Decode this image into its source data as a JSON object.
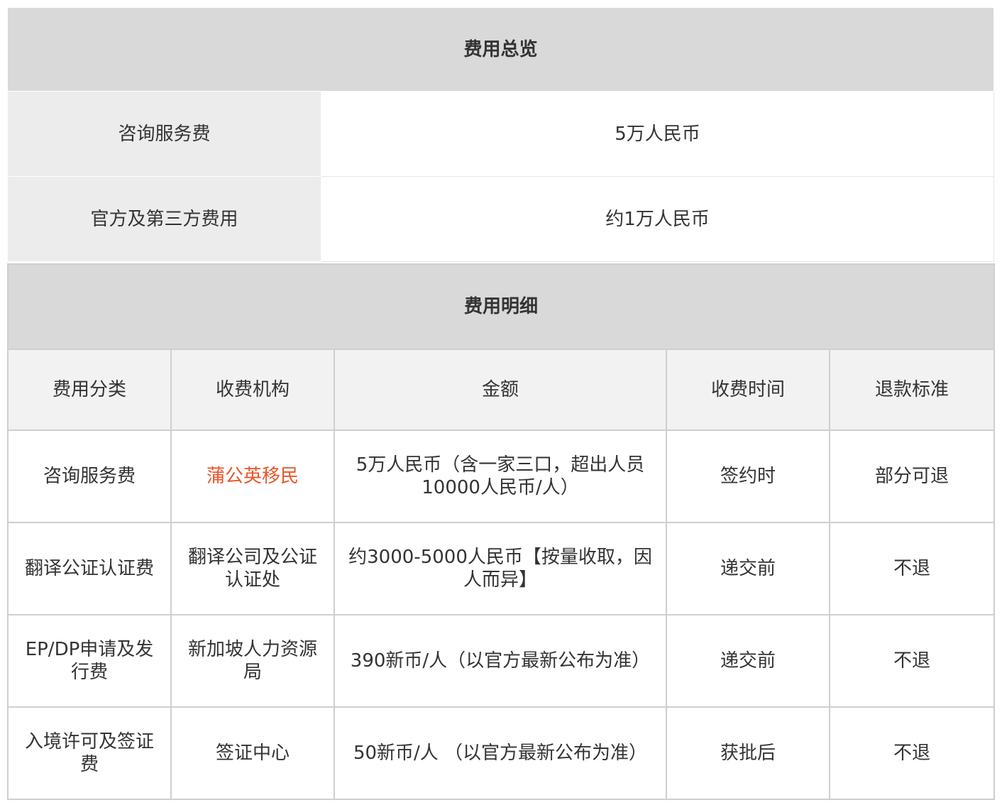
{
  "overview": {
    "title": "费用总览",
    "rows": [
      {
        "label": "咨询服务费",
        "value": "5万人民币"
      },
      {
        "label": "官方及第三方费用",
        "value": "约1万人民币"
      }
    ]
  },
  "detail": {
    "title": "费用明细",
    "headers": [
      "费用分类",
      "收费机构",
      "金额",
      "收费时间",
      "退款标准"
    ],
    "rows": [
      {
        "category": "咨询服务费",
        "agency": "蒲公英移民",
        "amount": "5万人民币（含一家三口，超出人员10000人民币/人）",
        "time": "签约时",
        "refund": "部分可退"
      },
      {
        "category": "翻译公证认证费",
        "agency": "翻译公司及公证认证处",
        "amount": "约3000-5000人民币【按量收取，因人而异】",
        "time": "递交前",
        "refund": "不退"
      },
      {
        "category": "EP/DP申请及发行费",
        "agency": "新加坡人力资源局",
        "amount": "390新币/人（以官方最新公布为准）",
        "time": "递交前",
        "refund": "不退"
      },
      {
        "category": "入境许可及签证费",
        "agency": "签证中心",
        "amount": "50新币/人 （以官方最新公布为准）",
        "time": "获批后",
        "refund": "不退"
      }
    ]
  },
  "colors": {
    "header_bg": "#d9d9d9",
    "label_bg": "#ececec",
    "accent": "#e8562a",
    "text": "#333333"
  }
}
